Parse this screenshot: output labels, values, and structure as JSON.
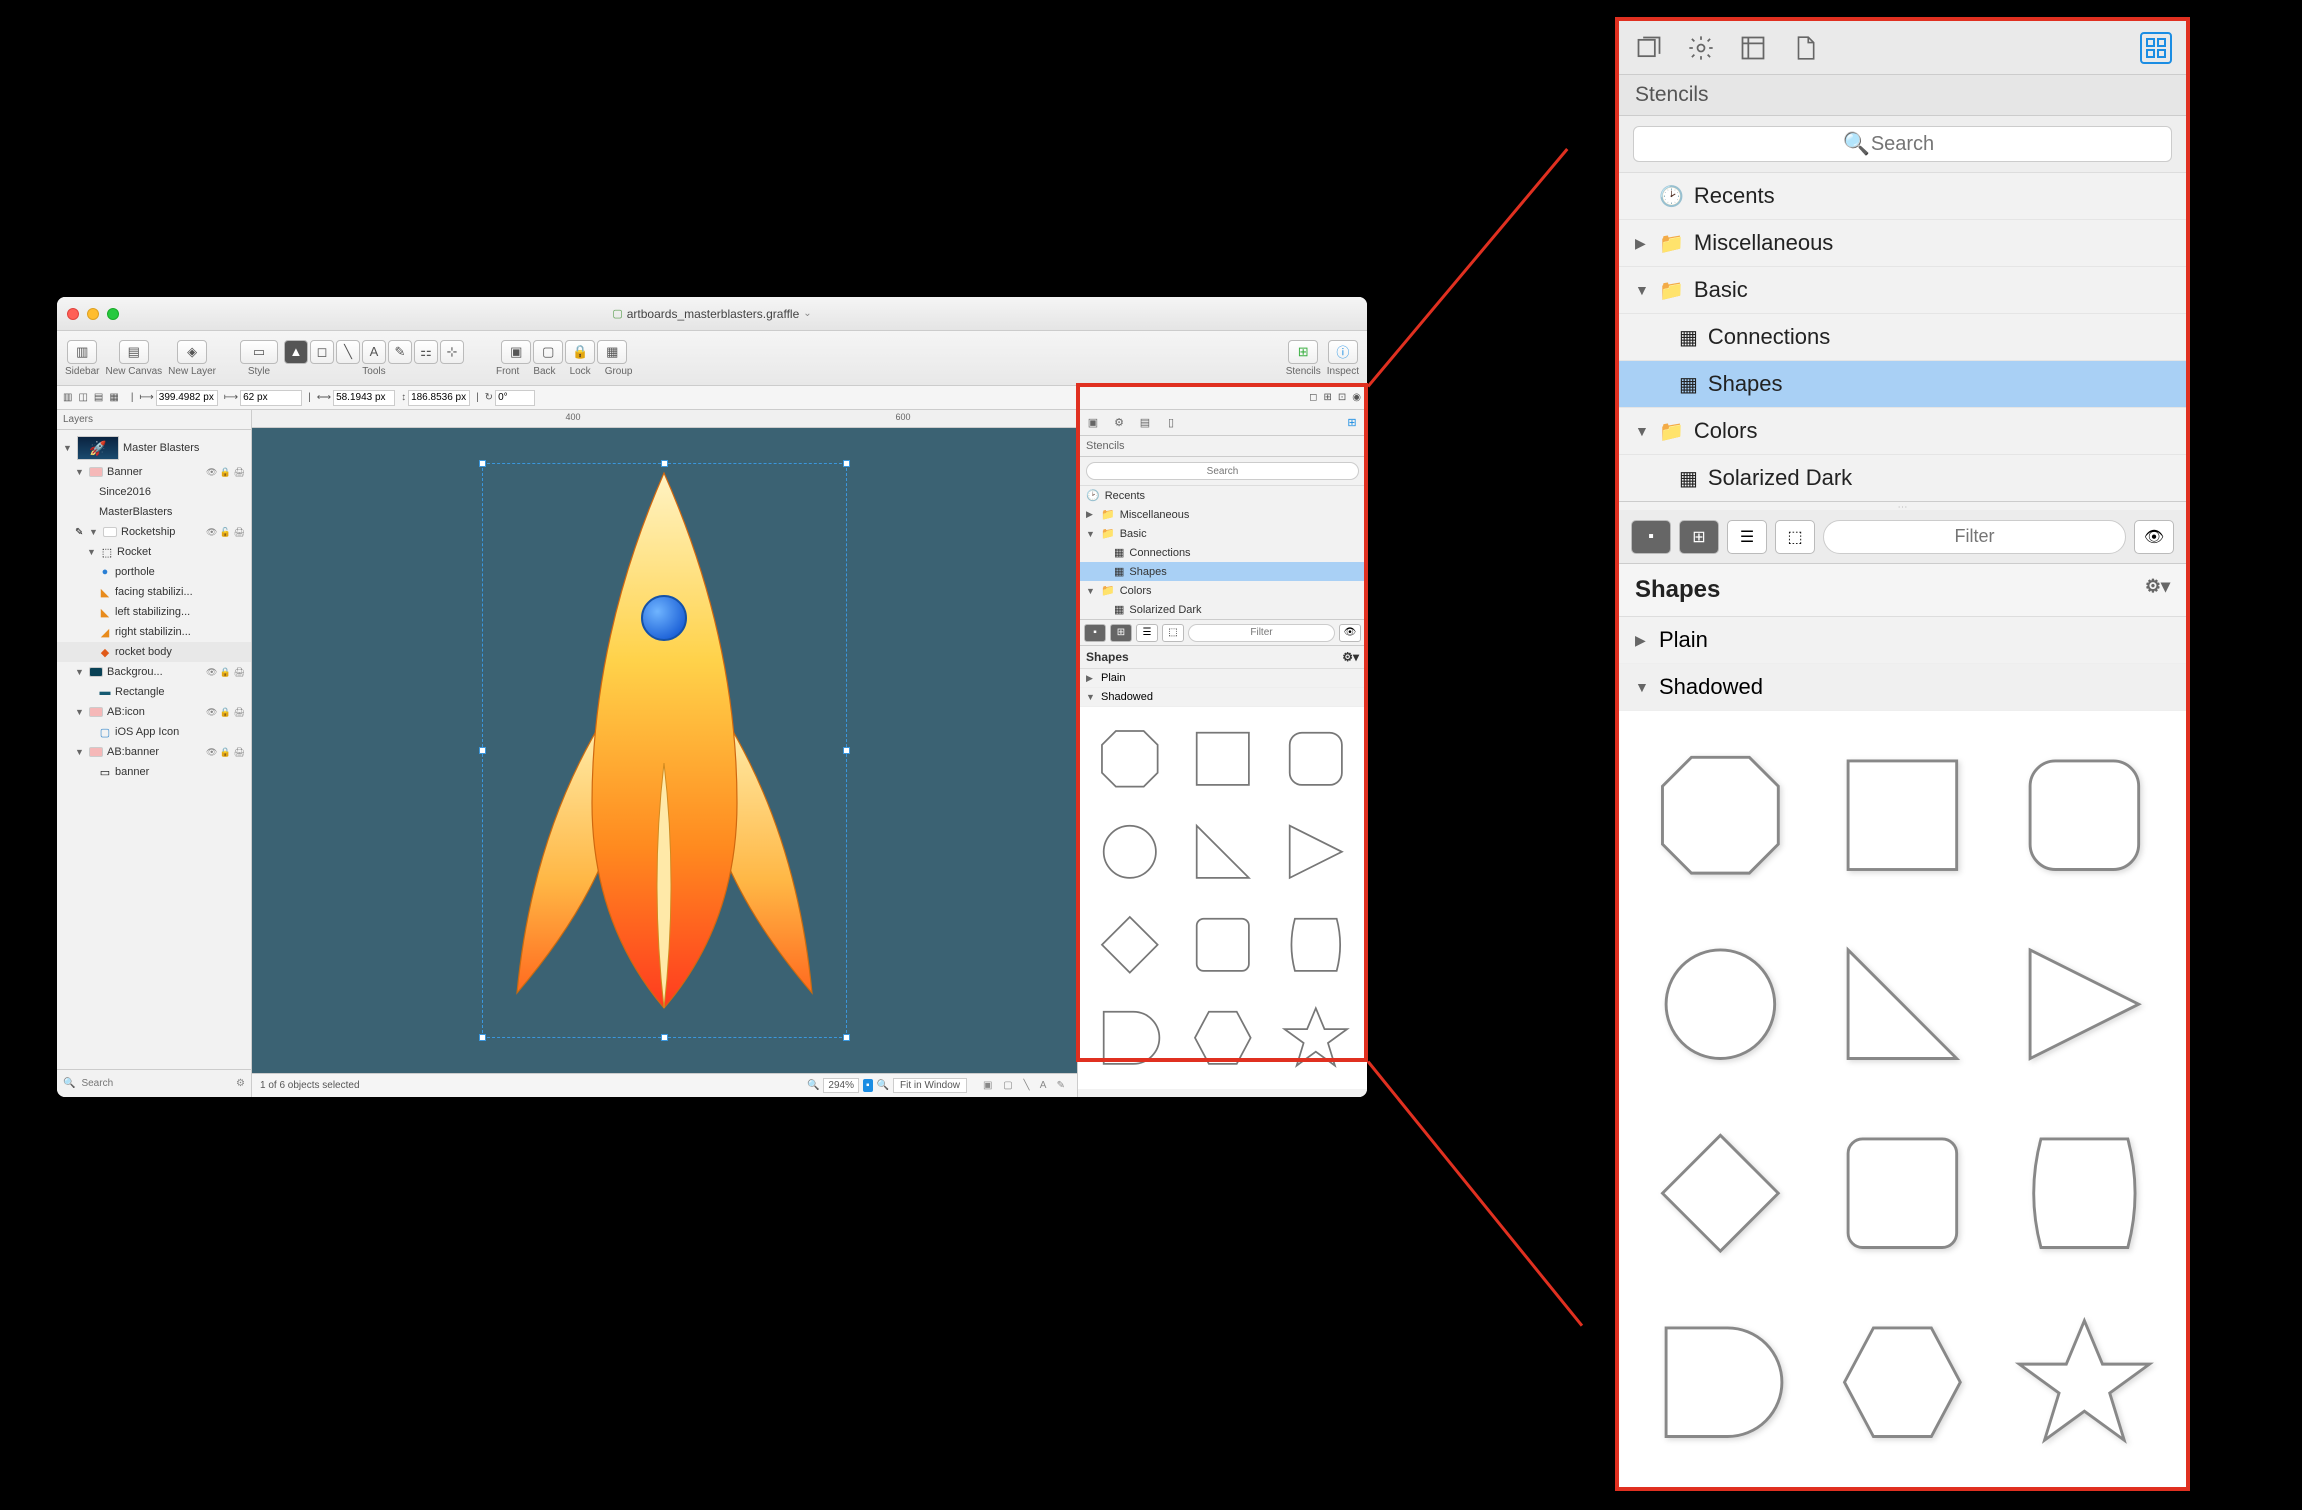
{
  "window": {
    "title": "artboards_masterblasters.graffle"
  },
  "toolbar": {
    "sidebar_label": "Sidebar",
    "new_canvas_label": "New Canvas",
    "new_layer_label": "New Layer",
    "style_label": "Style",
    "tools_label": "Tools",
    "front_label": "Front",
    "back_label": "Back",
    "lock_label": "Lock",
    "group_label": "Group",
    "stencils_label": "Stencils",
    "inspect_label": "Inspect"
  },
  "measure": {
    "x": "399.4982 px",
    "y": "62 px",
    "w": "58.1943 px",
    "h": "186.8536 px",
    "rotation": "0°"
  },
  "layers": {
    "title": "Layers",
    "items": [
      {
        "name": "Master Blasters",
        "type": "canvas"
      },
      {
        "name": "Banner",
        "type": "layer"
      },
      {
        "name": "Since2016",
        "type": "object"
      },
      {
        "name": "MasterBlasters",
        "type": "object"
      },
      {
        "name": "Rocketship",
        "type": "layer"
      },
      {
        "name": "Rocket",
        "type": "group"
      },
      {
        "name": "porthole",
        "type": "object"
      },
      {
        "name": "facing stabilizi...",
        "type": "object"
      },
      {
        "name": "left stabilizing...",
        "type": "object"
      },
      {
        "name": "right stabilizin...",
        "type": "object"
      },
      {
        "name": "rocket body",
        "type": "object"
      },
      {
        "name": "Backgrou...",
        "type": "layer"
      },
      {
        "name": "Rectangle",
        "type": "object"
      },
      {
        "name": "AB:icon",
        "type": "layer"
      },
      {
        "name": "iOS App Icon",
        "type": "object"
      },
      {
        "name": "AB:banner",
        "type": "layer"
      },
      {
        "name": "banner",
        "type": "object"
      }
    ],
    "search_placeholder": "Search"
  },
  "canvas": {
    "ruler_marks": [
      "400",
      "600"
    ],
    "status_text": "1 of 6 objects selected",
    "zoom": "294%",
    "fit_label": "Fit in Window"
  },
  "stencil_panel": {
    "title": "Stencils",
    "search_placeholder": "Search",
    "tree": {
      "recents": "Recents",
      "miscellaneous": "Miscellaneous",
      "basic": "Basic",
      "connections": "Connections",
      "shapes": "Shapes",
      "colors": "Colors",
      "solarized_dark": "Solarized Dark"
    },
    "filter_placeholder": "Filter",
    "section_title": "Shapes",
    "plain_label": "Plain",
    "shadowed_label": "Shadowed"
  }
}
